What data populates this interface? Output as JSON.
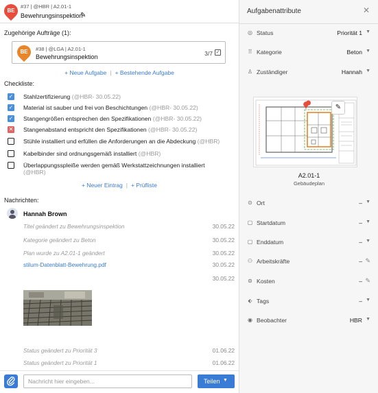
{
  "header": {
    "badge": "BE",
    "meta": "#37 | @HBR | A2.01-1",
    "title": "Bewehrungsinspektion",
    "edit_icon": "pencil-icon"
  },
  "related": {
    "label": "Zugehörige Aufträge (1):",
    "item": {
      "badge": "BE",
      "meta": "#38 | @LGA | A2.01-1",
      "title": "Bewehrungsinspektion",
      "progress": "3/7"
    },
    "new_task": "+ Neue Aufgabe",
    "existing_task": "+ Bestehende Aufgabe"
  },
  "checklist": {
    "label": "Checkliste:",
    "items": [
      {
        "text": "Stahlzertifizierung",
        "meta": "(@HBR- 30.05.22)",
        "state": "done"
      },
      {
        "text": "Material ist sauber und frei von Beschichtungen",
        "meta": "(@HBR- 30.05.22)",
        "state": "done"
      },
      {
        "text": "Stangengrößen entsprechen den Spezifikationen",
        "meta": "(@HBR- 30.05.22)",
        "state": "done"
      },
      {
        "text": "Stangenabstand entspricht den Spezifikationen",
        "meta": "(@HBR- 30.05.22)",
        "state": "fail"
      },
      {
        "text": "Stühle installiert und erfüllen die Anforderungen an die Abdeckung",
        "meta": "(@HBR)",
        "state": "open"
      },
      {
        "text": "Kabelbinder sind ordnungsgemäß installiert",
        "meta": "(@HBR)",
        "state": "open"
      },
      {
        "text": "Überlappungsspleiße werden gemäß Werkstattzeichnungen installiert",
        "meta": "(@HBR)",
        "state": "open"
      }
    ],
    "new_entry": "+ Neuer Eintrag",
    "checklist_link": "+ Prüfliste"
  },
  "messages": {
    "label": "Nachrichten:",
    "author": "Hannah Brown",
    "entries": [
      {
        "text": "Titel geändert zu Bewehrungsinspektion",
        "date": "30.05.22"
      },
      {
        "text": "Kategorie geändert zu Beton",
        "date": "30.05.22"
      },
      {
        "text": "Plan wurde zu A2.01-1 geändert",
        "date": "30.05.22"
      },
      {
        "text": "stilum-Datenblatt-Bewehrung.pdf",
        "date": "30.05.22"
      },
      {
        "text": "",
        "date": "30.05.22"
      },
      {
        "text": "Status geändert zu Priorität 3",
        "date": "01.06.22"
      },
      {
        "text": "Status geändert zu Priorität 1",
        "date": "01.06.22"
      }
    ]
  },
  "composer": {
    "placeholder": "Nachricht hier eingeben...",
    "share_label": "Teilen",
    "attach_icon": "paperclip-icon"
  },
  "panel": {
    "title": "Aufgabenattribute",
    "attributes": [
      {
        "label": "Status",
        "value": "Priorität 1",
        "icon": "status-icon"
      },
      {
        "label": "Kategorie",
        "value": "Beton",
        "icon": "grid-icon"
      },
      {
        "label": "Zuständiger",
        "value": "Hannah",
        "icon": "user-icon"
      },
      {
        "label": "Ort",
        "value": "–",
        "icon": "location-icon"
      },
      {
        "label": "Startdatum",
        "value": "–",
        "icon": "calendar-icon"
      },
      {
        "label": "Enddatum",
        "value": "–",
        "icon": "calendar-icon"
      },
      {
        "label": "Arbeitskräfte",
        "value": "–",
        "icon": "people-icon"
      },
      {
        "label": "Kosten",
        "value": "–",
        "icon": "currency-icon"
      },
      {
        "label": "Tags",
        "value": "–",
        "icon": "tag-icon"
      },
      {
        "label": "Beobachter",
        "value": "HBR",
        "icon": "eye-icon"
      }
    ],
    "plan": {
      "name": "A2.01-1",
      "subtitle": "Gebäudeplan"
    }
  },
  "colors": {
    "accent": "#3a7bd5",
    "pin_red": "#e74c3c",
    "pin_orange": "#e8852b",
    "check_done": "#4a8fdc",
    "check_fail": "#e06666"
  }
}
